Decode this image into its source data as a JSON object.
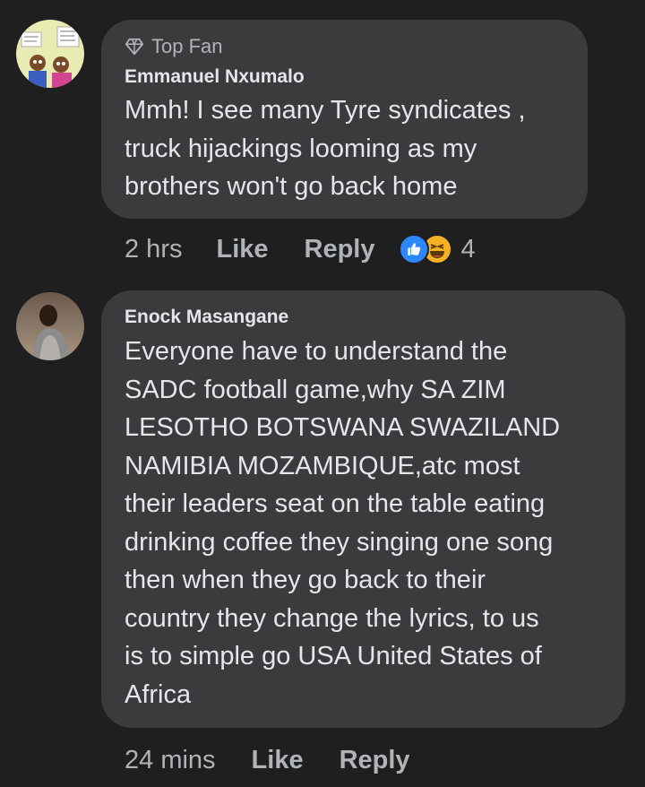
{
  "comments": [
    {
      "badge": "Top Fan",
      "author": "Emmanuel Nxumalo",
      "text": "Mmh! I see many Tyre syndicates ,\ntruck hijackings  looming as my\nbrothers won't go back home",
      "time": "2 hrs",
      "like_label": "Like",
      "reply_label": "Reply",
      "reactions": [
        "like-icon",
        "haha-icon"
      ],
      "reaction_count": "4"
    },
    {
      "author": "Enock Masangane",
      "text": "Everyone have to understand the\nSADC football game,why SA ZIM\nLESOTHO BOTSWANA SWAZILAND\nNAMIBIA MOZAMBIQUE,atc most\ntheir leaders seat on the table eating\ndrinking coffee they singing one song\nthen when they go back to their\ncountry they change the lyrics, to us\nis to simple go USA United States of\nAfrica",
      "time": "24 mins",
      "like_label": "Like",
      "reply_label": "Reply"
    }
  ],
  "colors": {
    "background": "#1f1f20",
    "bubble": "#3a3b3c",
    "primary_text": "#e4e6eb",
    "secondary_text": "#b0b3b8",
    "like_blue": "#2d88ff",
    "haha_yellow": "#f7b125"
  }
}
